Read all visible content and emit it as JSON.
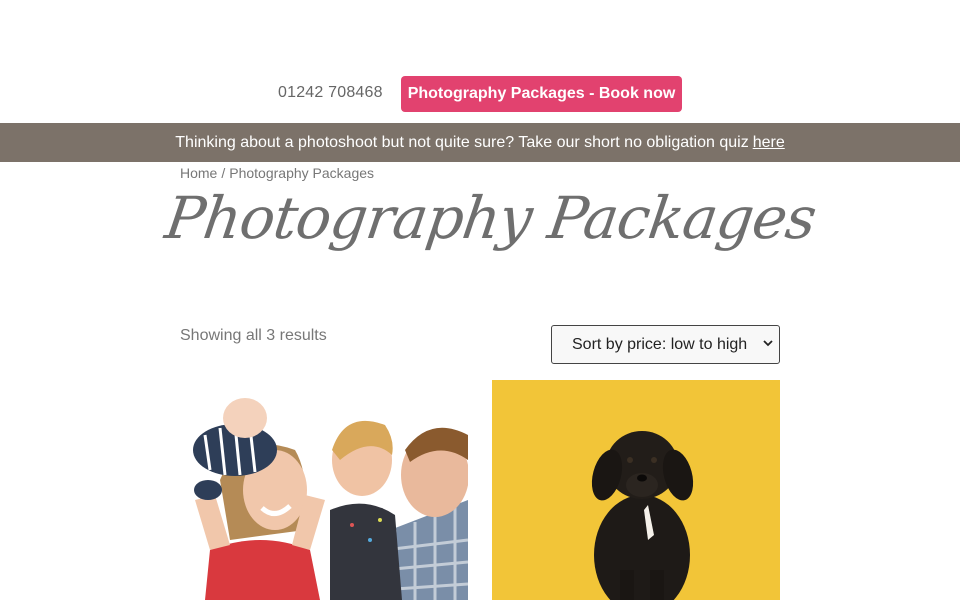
{
  "header": {
    "phone": "01242 708468",
    "book_button": "Photography Packages - Book now"
  },
  "banner": {
    "text": "Thinking about a photoshoot but not quite sure? Take our short no obligation quiz",
    "link": "here"
  },
  "breadcrumb": {
    "home": "Home",
    "separator": "/",
    "current": "Photography Packages"
  },
  "page_title": "Photography Packages",
  "results": {
    "count_text": "Showing all 3 results",
    "sort_selected": "Sort by price: low to high"
  },
  "colors": {
    "accent": "#e2426f",
    "banner_bg": "#7c7269",
    "product2_bg": "#f2c538"
  },
  "products": [
    {
      "image": "family-photo"
    },
    {
      "image": "dog-photo"
    }
  ]
}
